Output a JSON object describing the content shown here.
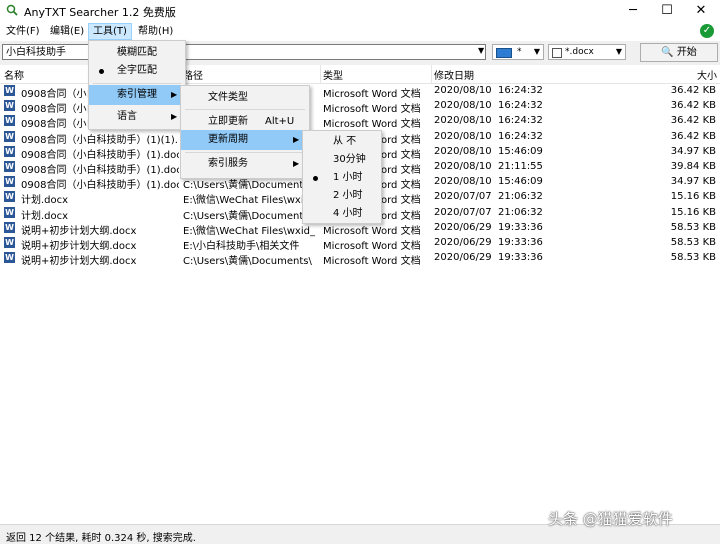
{
  "window": {
    "title": "AnyTXT Searcher 1.2 免费版",
    "minimize": "─",
    "maximize": "☐",
    "close": "✕"
  },
  "menubar": [
    {
      "label": "文件(F)"
    },
    {
      "label": "编辑(E)"
    },
    {
      "label": "工具(T)"
    },
    {
      "label": "帮助(H)"
    }
  ],
  "search": {
    "value": "小白科技助手",
    "location": "*",
    "filetype": "*.docx",
    "start_label": "开始"
  },
  "columns": {
    "name": "名称",
    "path": "路径",
    "type": "类型",
    "modified": "修改日期",
    "size": "大小"
  },
  "rows": [
    {
      "name": "0908合同（小白",
      "path": "",
      "type": "Microsoft Word 文档",
      "date": "2020/08/10  16:24:32",
      "size": "36.42 KB"
    },
    {
      "name": "0908合同（小白",
      "path": "",
      "type": "Microsoft Word 文档",
      "date": "2020/08/10  16:24:32",
      "size": "36.42 KB"
    },
    {
      "name": "0908合同（小白",
      "path": "",
      "type": "Microsoft Word 文档",
      "date": "2020/08/10  16:24:32",
      "size": "36.42 KB"
    },
    {
      "name": "0908合同（小白科技助手）(1)(1)....",
      "path": "",
      "type": "Microsoft Word 文档",
      "date": "2020/08/10  16:24:32",
      "size": "36.42 KB"
    },
    {
      "name": "0908合同（小白科技助手）(1).docx",
      "path": "",
      "type": "Microsoft Word 文档",
      "date": "2020/08/10  15:46:09",
      "size": "34.97 KB"
    },
    {
      "name": "0908合同（小白科技助手）(1).docx",
      "path": "",
      "type": "Microsoft Word 文档",
      "date": "2020/08/10  21:11:55",
      "size": "39.84 KB"
    },
    {
      "name": "0908合同（小白科技助手）(1).docx",
      "path": "C:\\Users\\黄儒\\Documents",
      "type": "Microsoft Word 文档",
      "date": "2020/08/10  15:46:09",
      "size": "34.97 KB"
    },
    {
      "name": "计划.docx",
      "path": "E:\\微信\\WeChat Files\\wxid_",
      "type": "Microsoft Word 文档",
      "date": "2020/07/07  21:06:32",
      "size": "15.16 KB"
    },
    {
      "name": "计划.docx",
      "path": "C:\\Users\\黄儒\\Documents",
      "type": "Microsoft Word 文档",
      "date": "2020/07/07  21:06:32",
      "size": "15.16 KB"
    },
    {
      "name": "说明+初步计划大纲.docx",
      "path": "E:\\微信\\WeChat Files\\wxid_",
      "type": "Microsoft Word 文档",
      "date": "2020/06/29  19:33:36",
      "size": "58.53 KB"
    },
    {
      "name": "说明+初步计划大纲.docx",
      "path": "E:\\小白科技助手\\相关文件",
      "type": "Microsoft Word 文档",
      "date": "2020/06/29  19:33:36",
      "size": "58.53 KB"
    },
    {
      "name": "说明+初步计划大纲.docx",
      "path": "C:\\Users\\黄儒\\Documents\\",
      "type": "Microsoft Word 文档",
      "date": "2020/06/29  19:33:36",
      "size": "58.53 KB"
    }
  ],
  "tools_menu": {
    "fuzzy": "模糊匹配",
    "exact": "全字匹配",
    "index_mgmt": "索引管理",
    "language": "语言"
  },
  "index_menu": {
    "file_types": "文件类型",
    "update_now": "立即更新",
    "update_now_shortcut": "Alt+U",
    "update_period": "更新周期",
    "index_service": "索引服务"
  },
  "period_menu": [
    "从 不",
    "30分钟",
    "1 小时",
    "2 小时",
    "4 小时"
  ],
  "status": {
    "text": "返回 12 个结果, 耗时 0.324 秒, 搜索完成."
  },
  "watermark": "头条 @猫猫爱软件",
  "colors": {
    "word_icon": "#2b5797",
    "highlight": "#91c9f7",
    "menu_active": "#cce8ff",
    "done": "#1a9a36"
  }
}
